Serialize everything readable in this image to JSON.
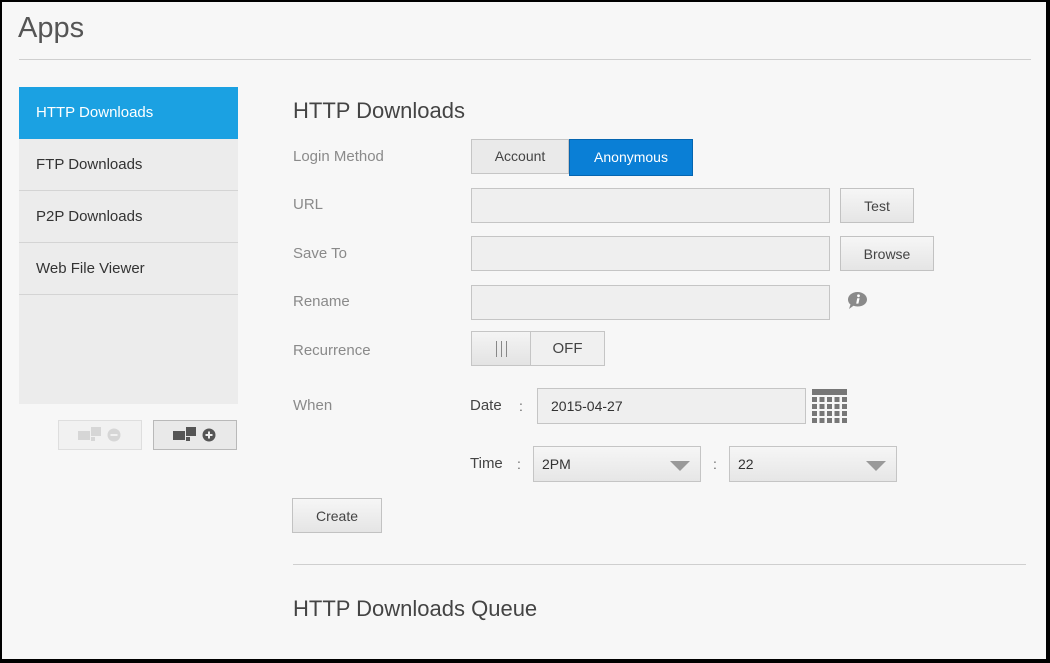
{
  "page": {
    "title": "Apps"
  },
  "sidebar": {
    "items": [
      {
        "label": "HTTP Downloads",
        "active": true
      },
      {
        "label": "FTP Downloads",
        "active": false
      },
      {
        "label": "P2P Downloads",
        "active": false
      },
      {
        "label": "Web File Viewer",
        "active": false
      }
    ],
    "remove_button_icon": "remove-app-icon",
    "add_button_icon": "add-app-icon"
  },
  "form": {
    "title": "HTTP Downloads",
    "login_method": {
      "label": "Login Method",
      "options": [
        "Account",
        "Anonymous"
      ],
      "selected": "Anonymous"
    },
    "url": {
      "label": "URL",
      "value": "",
      "button": "Test"
    },
    "save_to": {
      "label": "Save To",
      "value": "",
      "button": "Browse"
    },
    "rename": {
      "label": "Rename",
      "value": "",
      "icon": "info-icon"
    },
    "recurrence": {
      "label": "Recurrence",
      "state": "OFF"
    },
    "when": {
      "label": "When",
      "date_label": "Date",
      "date_value": "2015-04-27",
      "time_label": "Time",
      "hour": "2PM",
      "minute": "22",
      "colon": ":"
    },
    "create_button": "Create"
  },
  "queue": {
    "title": "HTTP Downloads Queue"
  },
  "colors": {
    "accent": "#1ba1e2",
    "selected_button": "#0a7fd6"
  }
}
